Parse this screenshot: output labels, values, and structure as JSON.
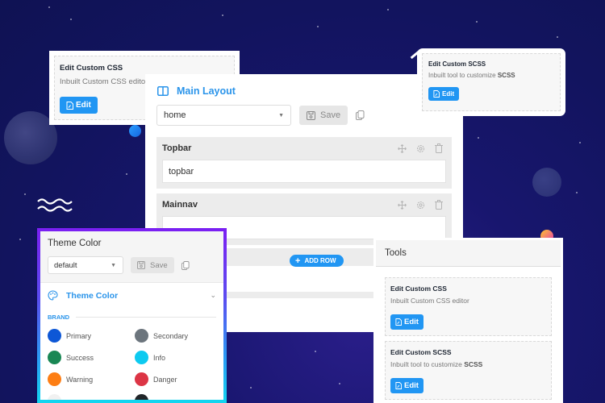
{
  "background": {
    "theme": "space",
    "accent_colors": {
      "primary_blue": "#2196f3",
      "gradient_start": "#7b1ff2",
      "gradient_end": "#13d6ef"
    }
  },
  "css_card": {
    "title": "Edit Custom CSS",
    "description": "Inbuilt Custom CSS editor",
    "edit_label": "Edit"
  },
  "scss_card": {
    "title": "Edit Custom SCSS",
    "description_prefix": "Inbuilt tool to customize ",
    "description_bold": "SCSS",
    "edit_label": "Edit"
  },
  "main_layout": {
    "title": "Main Layout",
    "layout_select_value": "home",
    "save_label": "Save",
    "add_row_label": "ADD ROW",
    "rows": [
      {
        "title": "Topbar",
        "content": "topbar"
      },
      {
        "title": "Mainnav",
        "content": ""
      }
    ]
  },
  "theme_color": {
    "title": "Theme Color",
    "select_value": "default",
    "save_label": "Save",
    "section_title": "Theme Color",
    "group_label": "BRAND",
    "swatches": [
      {
        "name": "Primary",
        "color": "#0d57d6"
      },
      {
        "name": "Secondary",
        "color": "#6c757d"
      },
      {
        "name": "Success",
        "color": "#198754"
      },
      {
        "name": "Info",
        "color": "#0dcaf0"
      },
      {
        "name": "Warning",
        "color": "#fd7e14"
      },
      {
        "name": "Danger",
        "color": "#dc3545"
      },
      {
        "name": "",
        "color": "#f8f9fa"
      },
      {
        "name": "",
        "color": "#212529"
      }
    ]
  },
  "tools": {
    "title": "Tools",
    "items": [
      {
        "title": "Edit Custom CSS",
        "description": "Inbuilt Custom CSS editor",
        "description_bold": "",
        "edit_label": "Edit"
      },
      {
        "title": "Edit Custom SCSS",
        "description": "Inbuilt tool to customize ",
        "description_bold": "SCSS",
        "edit_label": "Edit"
      }
    ]
  }
}
